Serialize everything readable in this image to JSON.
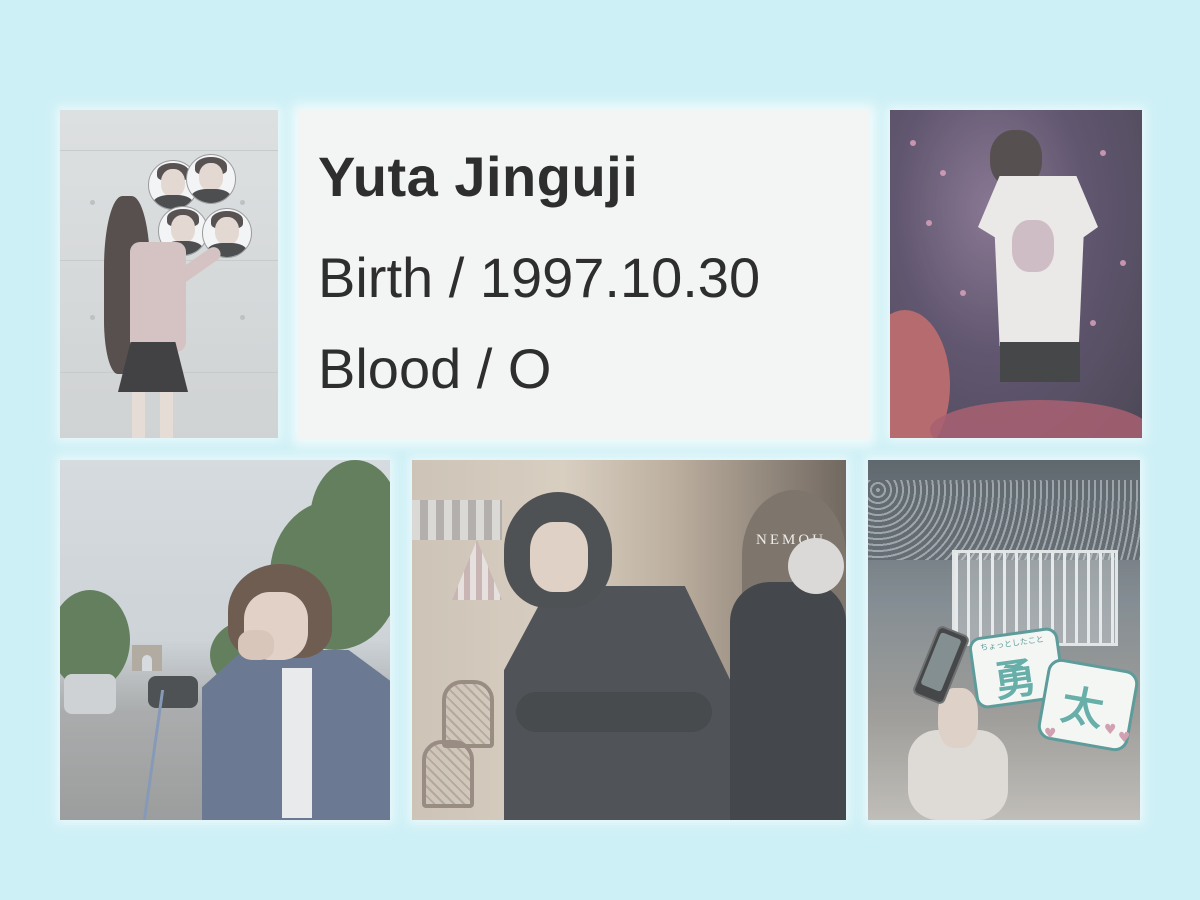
{
  "profile": {
    "name": "Yuta Jinguji",
    "birth_line": "Birth / 1997.10.30",
    "blood_line": "Blood / O"
  },
  "photos": {
    "cafe_sign": "NEMOU",
    "uchiwa_top": "ちょっとしたこと",
    "uchiwa_char1": "勇",
    "uchiwa_char2": "太"
  },
  "colors": {
    "background": "#cdf0f6",
    "card": "#f3f4f4",
    "text": "#2e2e2e",
    "uchiwa_text": "#35a69c"
  },
  "icons": [
    "heart-icon"
  ]
}
